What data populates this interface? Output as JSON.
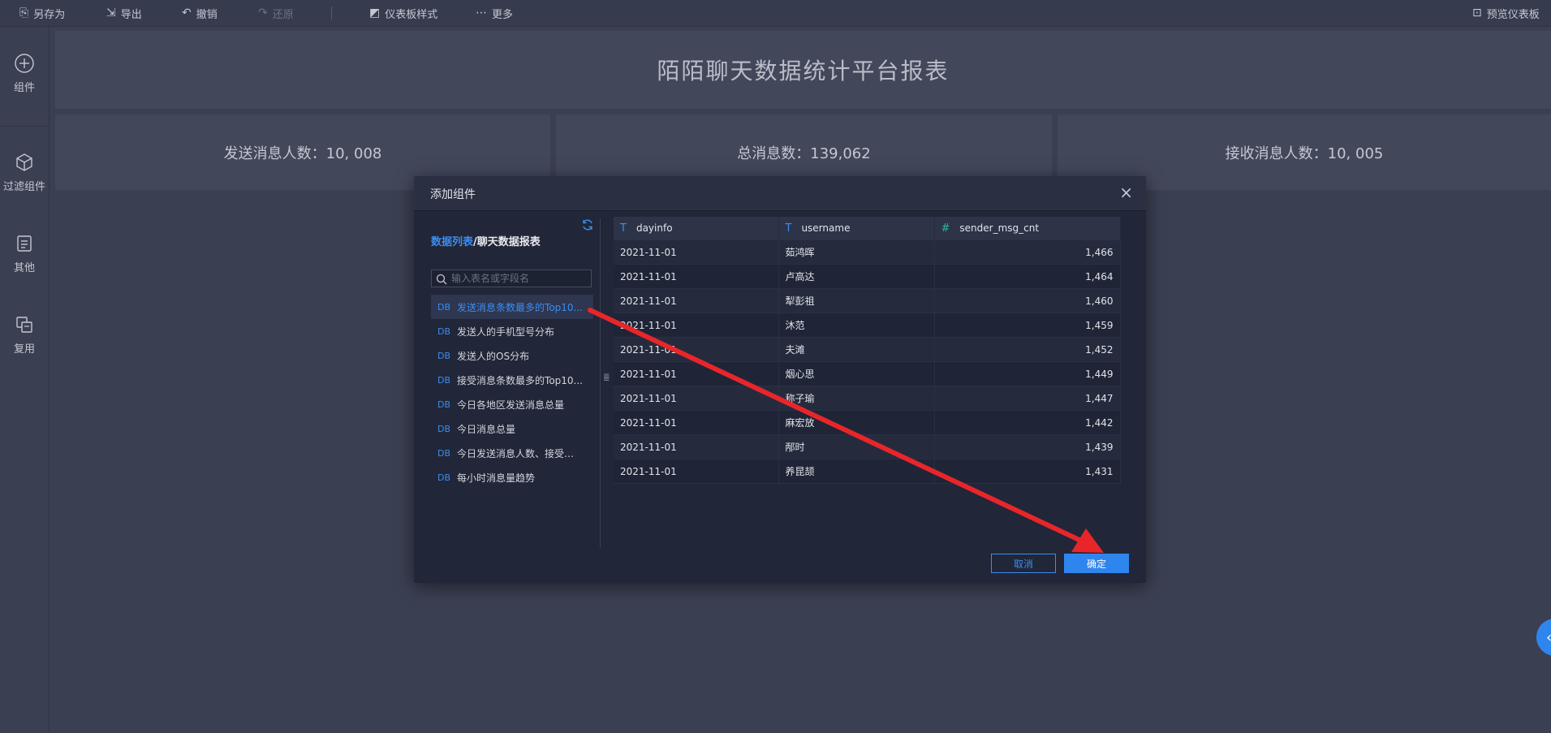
{
  "toolbar": {
    "save_as": "另存为",
    "export": "导出",
    "undo": "撤销",
    "redo": "还原",
    "dashboard_style": "仪表板样式",
    "more": "更多",
    "preview": "预览仪表板"
  },
  "sidebar": {
    "items": [
      {
        "label": "组件",
        "icon": "plus-circle-icon"
      },
      {
        "label": "过滤组件",
        "icon": "cube-icon"
      },
      {
        "label": "其他",
        "icon": "document-icon"
      },
      {
        "label": "复用",
        "icon": "copy-icon"
      }
    ]
  },
  "dashboard": {
    "title": "陌陌聊天数据统计平台报表",
    "kpis": [
      {
        "label": "发送消息人数：10, 008"
      },
      {
        "label": "总消息数：139,062"
      },
      {
        "label": "接收消息人数：10, 005"
      }
    ]
  },
  "modal": {
    "title": "添加组件",
    "breadcrumb_root": "数据列表",
    "breadcrumb_sep": "/",
    "breadcrumb_current": "聊天数据报表",
    "search_placeholder": "输入表名或字段名",
    "db_tag": "DB",
    "tables": [
      {
        "name": "发送消息条数最多的Top10...",
        "active": true
      },
      {
        "name": "发送人的手机型号分布",
        "active": false
      },
      {
        "name": "发送人的OS分布",
        "active": false
      },
      {
        "name": "接受消息条数最多的Top10...",
        "active": false
      },
      {
        "name": "今日各地区发送消息总量",
        "active": false
      },
      {
        "name": "今日消息总量",
        "active": false
      },
      {
        "name": "今日发送消息人数、接受消...",
        "active": false
      },
      {
        "name": "每小时消息量趋势",
        "active": false
      }
    ],
    "columns": [
      {
        "name": "dayinfo",
        "type_glyph": "T"
      },
      {
        "name": "username",
        "type_glyph": "T"
      },
      {
        "name": "sender_msg_cnt",
        "type_glyph": "#"
      }
    ],
    "rows": [
      [
        "2021-11-01",
        "茹鸿晖",
        "1,466"
      ],
      [
        "2021-11-01",
        "卢高达",
        "1,464"
      ],
      [
        "2021-11-01",
        "犁彭祖",
        "1,460"
      ],
      [
        "2021-11-01",
        "沐范",
        "1,459"
      ],
      [
        "2021-11-01",
        "夫滩",
        "1,452"
      ],
      [
        "2021-11-01",
        "烟心思",
        "1,449"
      ],
      [
        "2021-11-01",
        "称子瑜",
        "1,447"
      ],
      [
        "2021-11-01",
        "麻宏放",
        "1,442"
      ],
      [
        "2021-11-01",
        "邴时",
        "1,439"
      ],
      [
        "2021-11-01",
        "养昆颉",
        "1,431"
      ]
    ],
    "cancel": "取消",
    "confirm": "确定"
  },
  "colors": {
    "accent": "#2f85ee",
    "annotation_arrow": "#e8262a"
  }
}
